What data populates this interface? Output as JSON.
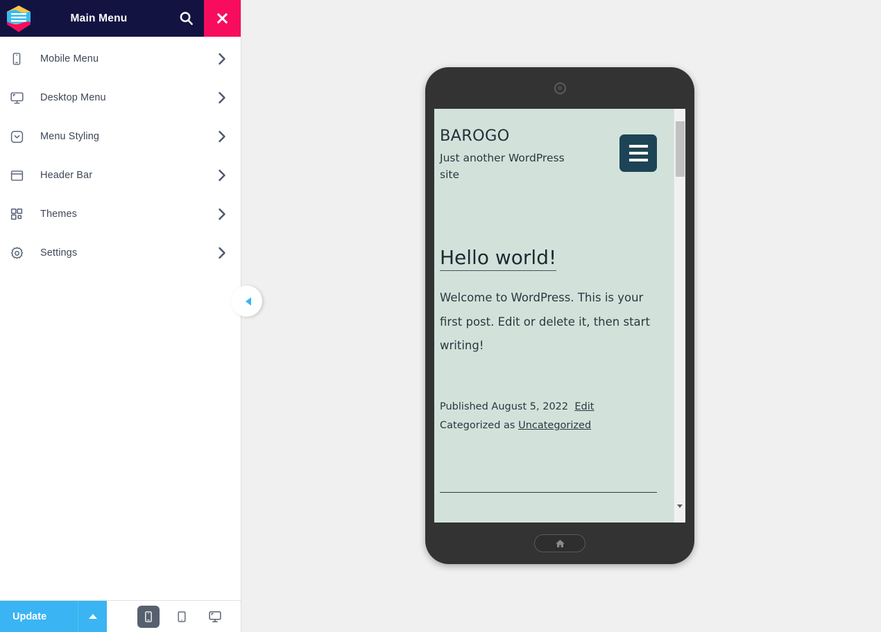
{
  "sidebar": {
    "header": {
      "title": "Main Menu",
      "logo_icon": "hexagon-menu-logo",
      "search_icon": "search-icon",
      "close_icon": "close-icon",
      "bg_color": "#131342",
      "close_color": "#f80c5d"
    },
    "items": [
      {
        "label": "Mobile Menu",
        "icon": "mobile-phone-icon",
        "chevron": "chevron-right-icon"
      },
      {
        "label": "Desktop Menu",
        "icon": "desktop-monitor-icon",
        "chevron": "chevron-right-icon"
      },
      {
        "label": "Menu Styling",
        "icon": "chevron-box-icon",
        "chevron": "chevron-right-icon"
      },
      {
        "label": "Header Bar",
        "icon": "window-frame-icon",
        "chevron": "chevron-right-icon"
      },
      {
        "label": "Themes",
        "icon": "grid-squares-icon",
        "chevron": "chevron-right-icon"
      },
      {
        "label": "Settings",
        "icon": "gear-icon",
        "chevron": "chevron-right-icon"
      }
    ],
    "footer": {
      "update_label": "Update",
      "update_color": "#3ab4f2",
      "caret_icon": "caret-up-icon",
      "devices": [
        {
          "name": "mobile",
          "icon": "mobile-device-icon",
          "active": true
        },
        {
          "name": "tablet",
          "icon": "tablet-device-icon",
          "active": false
        },
        {
          "name": "desktop",
          "icon": "desktop-device-icon",
          "active": false
        }
      ]
    },
    "collapse_handle_icon": "triangle-left-icon"
  },
  "preview": {
    "device": "mobile",
    "camera_icon": "camera-dot-icon",
    "home_icon": "home-icon",
    "site": {
      "title": "BAROGO",
      "tagline": "Just another WordPress site",
      "nav_toggle_icon": "hamburger-menu-icon",
      "nav_toggle_color": "#1d4456",
      "bg_color": "#d2e2da",
      "post": {
        "title": "Hello world!",
        "body": "Welcome to WordPress. This is your first post. Edit or delete it, then start writing!",
        "published_prefix": "Published August 5, 2022",
        "edit_link": "Edit",
        "category_prefix": "Categorized as",
        "category_link": "Uncategorized"
      }
    },
    "scrollbar": {
      "up_icon": "scroll-up-arrow-icon",
      "down_icon": "scroll-down-arrow-icon"
    }
  }
}
